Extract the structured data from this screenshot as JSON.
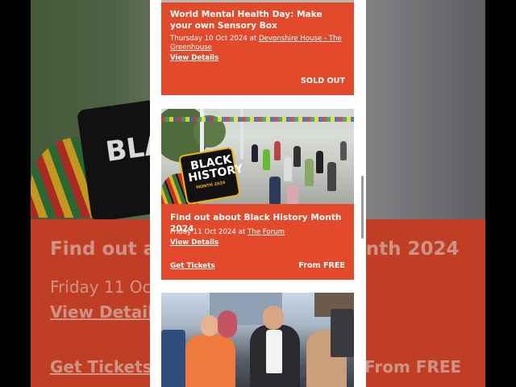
{
  "events": [
    {
      "title": "World Mental Health Day: Make your own Sensory Box",
      "date": "Thursday 10 Oct 2024",
      "at": "at",
      "venue_line1": "Devonshire House - The",
      "venue_line2": "Greenhouse",
      "details_label": "View Details",
      "status": "SOLD OUT"
    },
    {
      "title": "Find out about Black History Month 2024",
      "date": "Friday 11 Oct 2024",
      "at": "at",
      "venue": "The Forum",
      "details_label": "View Details",
      "tickets_label": "Get Tickets",
      "price": "From FREE",
      "image_sign_line1": "BLACK",
      "image_sign_line2": "HISTORY",
      "image_sign_sub": "MONTH 2024"
    },
    {
      "image": "people-crowd-photo"
    }
  ],
  "background": {
    "title_left": "Find out a",
    "title_right": "onth 2024",
    "date": "Friday 11 Oct",
    "details": "View Details",
    "tickets": "Get Tickets",
    "price": "From FREE",
    "sign": "BLACK HISTORY"
  },
  "colors": {
    "card_red": "#e24a2b",
    "page_white": "#ffffff"
  }
}
